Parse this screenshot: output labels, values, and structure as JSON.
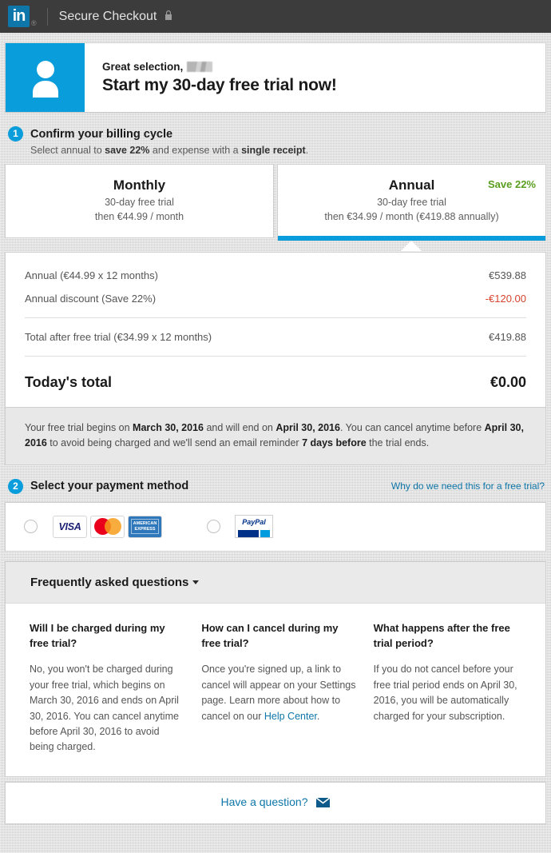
{
  "nav": {
    "logo_text": "in",
    "registered_mark": "®",
    "title": "Secure Checkout",
    "lock_icon": "lock-icon"
  },
  "hero": {
    "avatar_icon": "user-avatar-icon",
    "greeting": "Great selection,",
    "name_redacted": "",
    "headline": "Start my 30-day free trial now!"
  },
  "step1": {
    "number": "1",
    "title": "Confirm your billing cycle",
    "sub_prefix": "Select annual to ",
    "sub_bold1": "save 22%",
    "sub_middle": " and expense with a ",
    "sub_bold2": "single receipt",
    "sub_suffix": "."
  },
  "plans": [
    {
      "name": "Monthly",
      "trial": "30-day free trial",
      "price": "then €44.99 / month",
      "badge": "",
      "selected": false
    },
    {
      "name": "Annual",
      "trial": "30-day free trial",
      "price": "then €34.99 / month (€419.88 annually)",
      "badge": "Save 22%",
      "selected": true
    }
  ],
  "summary": {
    "rows": [
      {
        "label": "Annual (€44.99 x 12 months)",
        "value": "€539.88",
        "negative": false
      },
      {
        "label": "Annual discount (Save 22%)",
        "value": "-€120.00",
        "negative": true
      }
    ],
    "subtotal_label": "Total after free trial (€34.99 x 12 months)",
    "subtotal_value": "€419.88",
    "total_label": "Today's total",
    "total_value": "€0.00"
  },
  "trial_note": {
    "p1": "Your free trial begins on ",
    "b1": "March 30, 2016",
    "p2": " and will end on ",
    "b2": "April 30, 2016",
    "p3": ". You can cancel anytime before ",
    "b3": "April 30, 2016",
    "p4": " to avoid being charged and we'll send an email reminder ",
    "b4": "7 days before",
    "p5": " the trial ends."
  },
  "step2": {
    "number": "2",
    "title": "Select your payment method",
    "help_link": "Why do we need this for a free trial?"
  },
  "payment": {
    "card_option": {
      "radio_name": "credit-card-radio",
      "selected": false,
      "logos": [
        "VISA",
        "MasterCard",
        "AMERICAN EXPRESS"
      ]
    },
    "paypal_option": {
      "radio_name": "paypal-radio",
      "selected": false,
      "label": "PayPal"
    }
  },
  "faq": {
    "heading": "Frequently asked questions",
    "items": [
      {
        "question": "Will I be charged during my free trial?",
        "answer": "No, you won't be charged during your free trial, which begins on March 30, 2016 and ends on April 30, 2016. You can cancel anytime before April 30, 2016 to avoid being charged."
      },
      {
        "question": "How can I cancel during my free trial?",
        "answer_before_link": "Once you're signed up, a link to cancel will appear on your Settings page. Learn more about how to cancel on our ",
        "answer_link": "Help Center",
        "answer_after_link": "."
      },
      {
        "question": "What happens after the free trial period?",
        "answer": "If you do not cancel before your free trial period ends on April 30, 2016, you will be automatically charged for your subscription."
      }
    ]
  },
  "footer": {
    "link": "Have a question?",
    "mail_icon": "envelope-icon"
  },
  "colors": {
    "linkedin_blue": "#0a9ddb",
    "link_blue": "#0e76a8",
    "nav_dark": "#3c3c3c",
    "save_green": "#5a9e20",
    "discount_red": "#d9442e"
  }
}
